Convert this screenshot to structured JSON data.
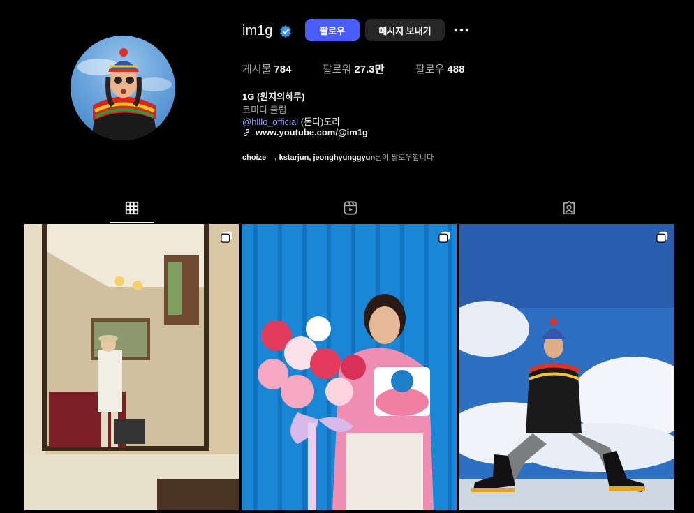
{
  "profile": {
    "username": "im1g",
    "follow_label": "팔로우",
    "message_label": "메시지 보내기"
  },
  "stats": {
    "posts_label": "게시물",
    "posts_value": "784",
    "followers_label": "팔로워",
    "followers_value": "27.3만",
    "following_label": "팔로우",
    "following_value": "488"
  },
  "bio": {
    "name": "1G (원지의하루)",
    "category": "코미디 클럽",
    "mention": "@hlllo_official",
    "mention_suffix": " (돈다)도라",
    "link": "www.youtube.com/@im1g",
    "followed_by_names": "choize__, kstarjun, jeonghyunggyun",
    "followed_by_suffix": "님이 팔로우합니다"
  },
  "tabs": [
    {
      "icon": "grid-icon",
      "active": true
    },
    {
      "icon": "reels-icon",
      "active": false
    },
    {
      "icon": "tagged-icon",
      "active": false
    }
  ],
  "colors": {
    "follow_button": "#4a5df9",
    "message_button": "#262626",
    "verified_badge": "#3897f0",
    "link_blue": "#8fa7ff"
  }
}
